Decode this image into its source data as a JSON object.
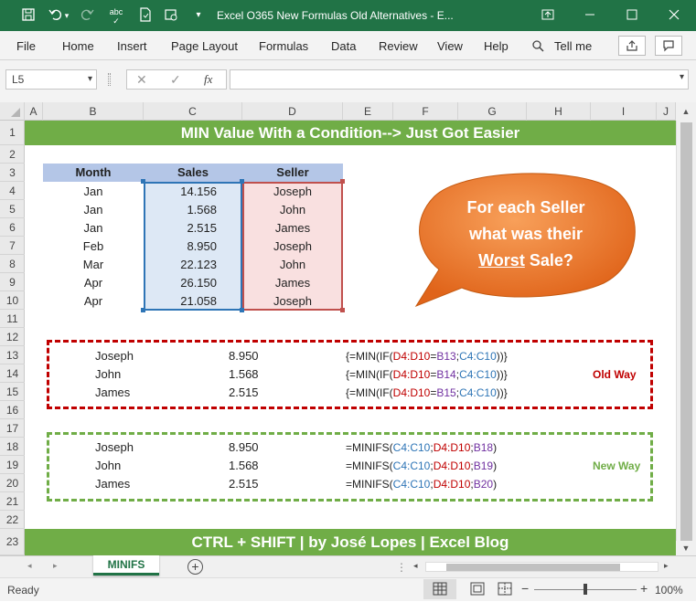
{
  "window": {
    "title": "Excel O365 New Formulas Old Alternatives  -  E...",
    "qat": [
      "save-icon",
      "undo-icon",
      "redo-icon",
      "spelling-icon",
      "new-doc-icon",
      "print-preview-icon",
      "customize-icon"
    ]
  },
  "ribbon": {
    "tabs": [
      "File",
      "Home",
      "Insert",
      "Page Layout",
      "Formulas",
      "Data",
      "Review",
      "View",
      "Help"
    ],
    "tell_me": "Tell me"
  },
  "formula_bar": {
    "name_box": "L5",
    "fx": "fx",
    "value": ""
  },
  "columns": [
    "A",
    "B",
    "C",
    "D",
    "E",
    "F",
    "G",
    "H",
    "I",
    "J"
  ],
  "rows": [
    "1",
    "2",
    "3",
    "4",
    "5",
    "6",
    "7",
    "8",
    "9",
    "10",
    "11",
    "12",
    "13",
    "14",
    "15",
    "16",
    "17",
    "18",
    "19",
    "20",
    "21",
    "22",
    "23"
  ],
  "sheet": {
    "title_banner": "MIN Value With a Condition--> Just Got Easier",
    "footer_banner": "CTRL + SHIFT  |  by José Lopes  |  Excel Blog",
    "table_headers": {
      "month": "Month",
      "sales": "Sales",
      "seller": "Seller"
    },
    "table_rows": [
      {
        "month": "Jan",
        "sales": "14.156",
        "seller": "Joseph"
      },
      {
        "month": "Jan",
        "sales": "1.568",
        "seller": "John"
      },
      {
        "month": "Jan",
        "sales": "2.515",
        "seller": "James"
      },
      {
        "month": "Feb",
        "sales": "8.950",
        "seller": "Joseph"
      },
      {
        "month": "Mar",
        "sales": "22.123",
        "seller": "John"
      },
      {
        "month": "Apr",
        "sales": "26.150",
        "seller": "James"
      },
      {
        "month": "Apr",
        "sales": "21.058",
        "seller": "Joseph"
      }
    ],
    "callout": {
      "line1": "For each Seller",
      "line2": "what was their",
      "worst": "Worst",
      "sale": " Sale?"
    },
    "old_way": {
      "label": "Old Way",
      "rows": [
        {
          "name": "Joseph",
          "value": "8.950",
          "f1": "{=MIN(IF(",
          "r1": "D4:D10",
          "eq": "=",
          "r2": "B13",
          ";": ";",
          "r3": "C4:C10",
          "end": "))}"
        },
        {
          "name": "John",
          "value": "1.568",
          "f1": "{=MIN(IF(",
          "r1": "D4:D10",
          "eq": "=",
          "r2": "B14",
          ";": ";",
          "r3": "C4:C10",
          "end": "))}"
        },
        {
          "name": "James",
          "value": "2.515",
          "f1": "{=MIN(IF(",
          "r1": "D4:D10",
          "eq": "=",
          "r2": "B15",
          ";": ";",
          "r3": "C4:C10",
          "end": "))}"
        }
      ]
    },
    "new_way": {
      "label": "New Way",
      "rows": [
        {
          "name": "Joseph",
          "value": "8.950",
          "f1": "=MINIFS(",
          "r1": "C4:C10",
          "s1": ";",
          "r2": "D4:D10",
          "s2": ";",
          "r3": "B18",
          "end": ")"
        },
        {
          "name": "John",
          "value": "1.568",
          "f1": "=MINIFS(",
          "r1": "C4:C10",
          "s1": ";",
          "r2": "D4:D10",
          "s2": ";",
          "r3": "B19",
          "end": ")"
        },
        {
          "name": "James",
          "value": "2.515",
          "f1": "=MINIFS(",
          "r1": "C4:C10",
          "s1": ";",
          "r2": "D4:D10",
          "s2": ";",
          "r3": "B20",
          "end": ")"
        }
      ]
    }
  },
  "sheet_tab": "MINIFS",
  "status": {
    "ready": "Ready",
    "zoom": "100%"
  },
  "colors": {
    "excel_green": "#217346",
    "banner_green": "#70ad47",
    "callout_orange": "#ed7d31",
    "red": "#c00000",
    "blue": "#2e75b6",
    "purple": "#7030a0"
  }
}
